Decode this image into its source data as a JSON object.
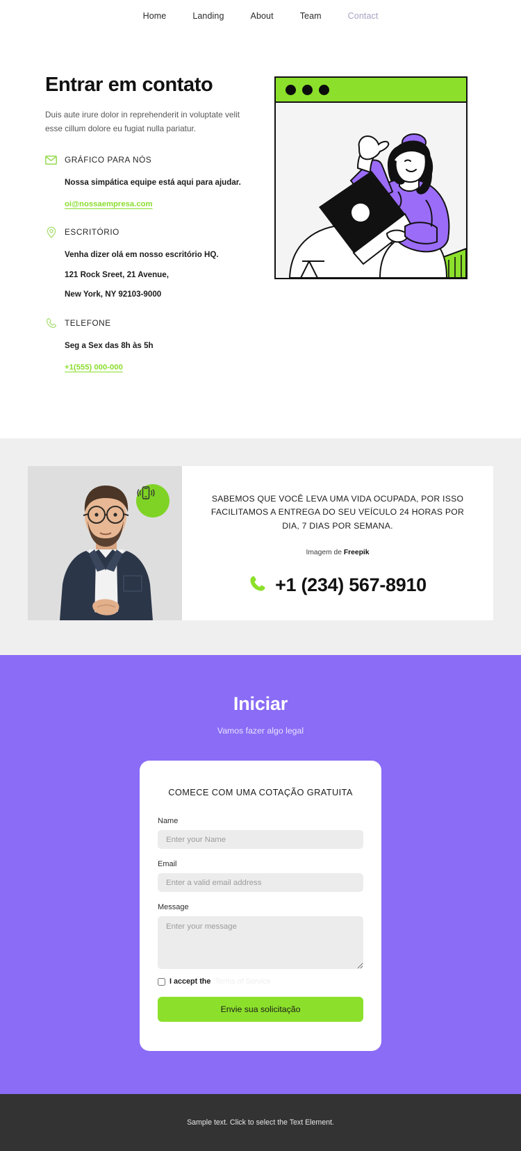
{
  "nav": {
    "items": [
      {
        "label": "Home",
        "active": false
      },
      {
        "label": "Landing",
        "active": false
      },
      {
        "label": "About",
        "active": false
      },
      {
        "label": "Team",
        "active": false
      },
      {
        "label": "Contact",
        "active": true
      }
    ]
  },
  "hero": {
    "title": "Entrar em contato",
    "subtitle": "Duis aute irure dolor in reprehenderit in voluptate velit esse cillum dolore eu fugiat nulla pariatur.",
    "blocks": [
      {
        "icon": "envelope-icon",
        "title": "GRÁFICO PARA NÓS",
        "strong": "Nossa simpática equipe está aqui para ajudar.",
        "lines": [],
        "link": "oi@nossaempresa.com"
      },
      {
        "icon": "map-pin-icon",
        "title": "ESCRITÓRIO",
        "strong": "Venha dizer olá em nosso escritório HQ.",
        "lines": [
          "121 Rock Sreet, 21 Avenue,",
          "New York, NY 92103-9000"
        ],
        "link": ""
      },
      {
        "icon": "phone-icon",
        "title": "TELEFONE",
        "strong": "Seg a Sex das 8h às 5h",
        "lines": [],
        "link": "+1(555) 000-000"
      }
    ],
    "illustration": {
      "alt": "woman-with-laptop-illustration",
      "window_dots": 3,
      "bar_color": "#8CE02B",
      "accent_color": "#9B6CF8"
    }
  },
  "promo": {
    "photo_alt": "man-with-glasses-photo",
    "badge_icon": "vibrating-phone-icon",
    "headline": "SABEMOS QUE VOCÊ LEVA UMA VIDA OCUPADA, POR ISSO FACILITAMOS A ENTREGA DO SEU VEÍCULO 24 HORAS POR DIA, 7 DIAS POR SEMANA.",
    "credit_prefix": "Imagem de ",
    "credit_source": "Freepik",
    "phone_icon": "phone-handset-icon",
    "phone": "+1 (234) 567-8910"
  },
  "cta": {
    "title": "Iniciar",
    "subtitle": "Vamos fazer algo legal",
    "form": {
      "title": "COMECE COM UMA COTAÇÃO GRATUITA",
      "fields": [
        {
          "label": "Name",
          "placeholder": "Enter your Name",
          "value": "",
          "type": "text"
        },
        {
          "label": "Email",
          "placeholder": "Enter a valid email address",
          "value": "",
          "type": "text"
        }
      ],
      "message": {
        "label": "Message",
        "placeholder": "Enter your message",
        "value": ""
      },
      "accept_text": "I accept the",
      "accept_link": "Terms of Service",
      "accept_checked": false,
      "submit_label": "Envie sua solicitação"
    }
  },
  "footer": {
    "text": "Sample text. Click to select the Text Element."
  },
  "colors": {
    "green": "#8CE02B",
    "purple": "#8A6CF6",
    "badge_green": "#7FD325",
    "gray_band": "#EFEFEF",
    "footer": "#333333"
  }
}
